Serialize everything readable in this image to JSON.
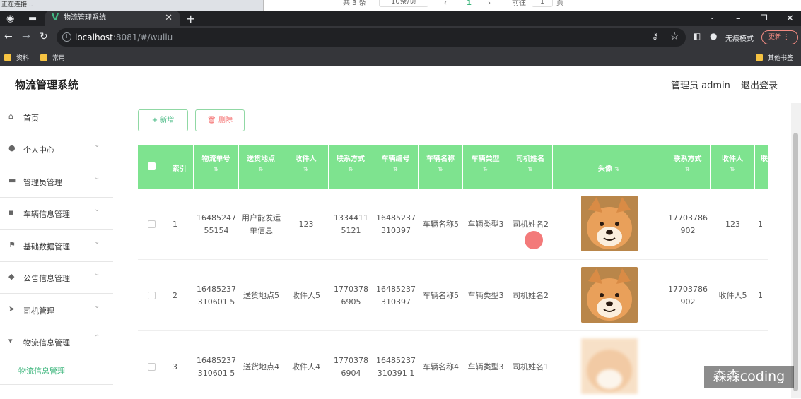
{
  "top_overlay": {
    "status": "正在连接...",
    "total": "共 3 条",
    "page_size": "10条/页",
    "current_page": "1",
    "goto_label": "前往",
    "goto_value": "1",
    "page_unit": "页"
  },
  "browser": {
    "tab_title": "物流管理系统",
    "url_host": "localhost",
    "url_rest": ":8081/#/wuliu",
    "incognito_label": "无痕模式",
    "update_label": "更新",
    "bookmarks": [
      "资料",
      "常用"
    ],
    "other_bookmarks": "其他书签"
  },
  "header": {
    "title": "物流管理系统",
    "user": "管理员 admin",
    "logout": "退出登录"
  },
  "sidebar": {
    "items": [
      {
        "label": "首页",
        "icon": "home-icon"
      },
      {
        "label": "个人中心",
        "icon": "user-icon"
      },
      {
        "label": "管理员管理",
        "icon": "briefcase-icon"
      },
      {
        "label": "车辆信息管理",
        "icon": "chat-icon"
      },
      {
        "label": "基础数据管理",
        "icon": "flag-icon"
      },
      {
        "label": "公告信息管理",
        "icon": "location-icon"
      },
      {
        "label": "司机管理",
        "icon": "send-icon"
      },
      {
        "label": "物流信息管理",
        "icon": "stamp-icon"
      }
    ],
    "sub_item": "物流信息管理"
  },
  "toolbar": {
    "add": "新增",
    "delete": "删除"
  },
  "table": {
    "columns": [
      "索引",
      "物流单号",
      "送货地点",
      "收件人",
      "联系方式",
      "车辆编号",
      "车辆名称",
      "车辆类型",
      "司机姓名",
      "头像",
      "联系方式",
      "收件人",
      "联"
    ],
    "rows": [
      {
        "idx": "1",
        "no": "1648524755154",
        "place": "用户能发运单信息",
        "recv": "123",
        "phone": "13344115121",
        "car_no": "16485237310397",
        "car_name": "车辆名称5",
        "car_type": "车辆类型3",
        "driver": "司机姓名2",
        "phone2": "17703786902",
        "recv2": "123",
        "more": "1"
      },
      {
        "idx": "2",
        "no": "16485237310601 5",
        "place": "送货地点5",
        "recv": "收件人5",
        "phone": "17703786905",
        "car_no": "16485237310397",
        "car_name": "车辆名称5",
        "car_type": "车辆类型3",
        "driver": "司机姓名2",
        "phone2": "17703786902",
        "recv2": "收件人5",
        "more": "1"
      },
      {
        "idx": "3",
        "no": "16485237310601 5",
        "place": "送货地点4",
        "recv": "收件人4",
        "phone": "17703786904",
        "car_no": "16485237310391 1",
        "car_name": "车辆名称4",
        "car_type": "车辆类型3",
        "driver": "司机姓名1",
        "phone2": "",
        "recv2": "",
        "more": ""
      }
    ]
  },
  "watermark": "森森coding",
  "colors": {
    "header_green": "#7ee38f",
    "accent": "#3bb57b",
    "danger": "#f56c6c"
  }
}
